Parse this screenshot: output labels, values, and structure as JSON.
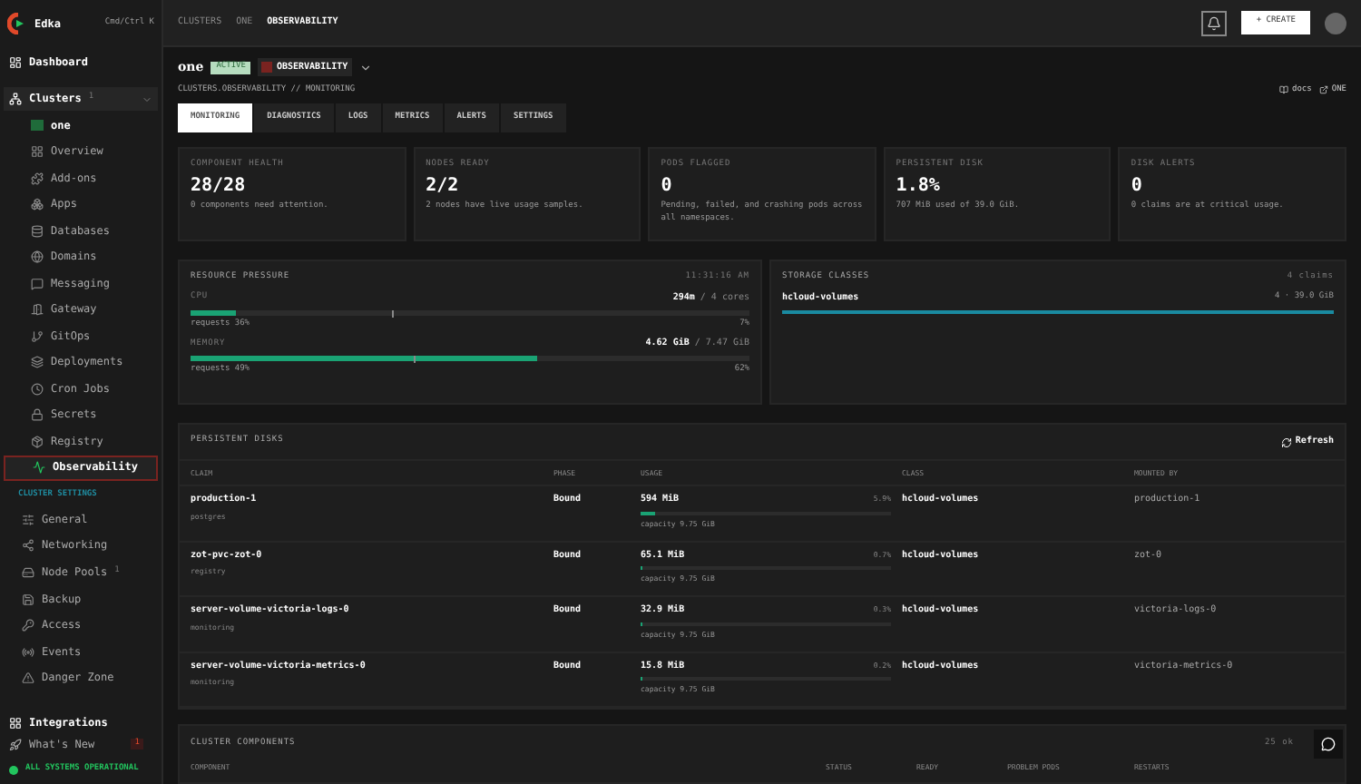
{
  "brand": {
    "name": "Edka",
    "shortcut": "Cmd/Ctrl K"
  },
  "sidebar": {
    "dashboard": "Dashboard",
    "clusters": {
      "label": "Clusters",
      "count": "1",
      "expanded": true
    },
    "items": [
      {
        "label": "one",
        "selected": false,
        "kind": "cluster"
      },
      {
        "label": "Overview",
        "selected": false,
        "kind": "page"
      },
      {
        "label": "Add-ons",
        "selected": false,
        "kind": "page"
      },
      {
        "label": "Apps",
        "selected": false,
        "kind": "page"
      },
      {
        "label": "Databases",
        "selected": false,
        "kind": "page"
      },
      {
        "label": "Domains",
        "selected": false,
        "kind": "page"
      },
      {
        "label": "Messaging",
        "selected": false,
        "kind": "page"
      },
      {
        "label": "Gateway",
        "selected": false,
        "kind": "page"
      },
      {
        "label": "GitOps",
        "selected": false,
        "kind": "page"
      },
      {
        "label": "Deployments",
        "selected": false,
        "kind": "page"
      },
      {
        "label": "Cron Jobs",
        "selected": false,
        "kind": "page"
      },
      {
        "label": "Secrets",
        "selected": false,
        "kind": "page"
      },
      {
        "label": "Registry",
        "selected": false,
        "kind": "page"
      },
      {
        "label": "Observability",
        "selected": true,
        "kind": "page"
      }
    ],
    "settings_heading": "CLUSTER SETTINGS",
    "settings": [
      {
        "label": "General"
      },
      {
        "label": "Networking"
      },
      {
        "label": "Node Pools",
        "count": "1"
      },
      {
        "label": "Backup"
      },
      {
        "label": "Access"
      },
      {
        "label": "Events"
      },
      {
        "label": "Danger Zone"
      }
    ],
    "integrations": "Integrations",
    "whats_new": {
      "label": "What's New",
      "badge": "1"
    },
    "status": "ALL SYSTEMS OPERATIONAL"
  },
  "topbar": {
    "breadcrumbs": [
      {
        "label": "CLUSTERS",
        "selected": false
      },
      {
        "label": "ONE",
        "selected": false
      },
      {
        "label": "OBSERVABILITY",
        "selected": true
      }
    ],
    "create": "+ CREATE"
  },
  "header": {
    "cluster": "one",
    "status": "ACTIVE",
    "section": "OBSERVABILITY",
    "path": "CLUSTERS.OBSERVABILITY // MONITORING",
    "docs": "docs",
    "cluster_link": "ONE"
  },
  "tabs": [
    {
      "label": "MONITORING",
      "selected": true
    },
    {
      "label": "DIAGNOSTICS",
      "selected": false
    },
    {
      "label": "LOGS",
      "selected": false
    },
    {
      "label": "METRICS",
      "selected": false
    },
    {
      "label": "ALERTS",
      "selected": false
    },
    {
      "label": "SETTINGS",
      "selected": false
    }
  ],
  "stats": [
    {
      "label": "COMPONENT HEALTH",
      "value": "28/28",
      "note": "0 components need attention."
    },
    {
      "label": "NODES READY",
      "value": "2/2",
      "note": "2 nodes have live usage samples."
    },
    {
      "label": "PODS FLAGGED",
      "value": "0",
      "note": "Pending, failed, and crashing pods across all namespaces."
    },
    {
      "label": "PERSISTENT DISK",
      "value": "1.8%",
      "note": "707 MiB used of 39.0 GiB."
    },
    {
      "label": "DISK ALERTS",
      "value": "0",
      "note": "0 claims are at critical usage."
    }
  ],
  "resource_pressure": {
    "title": "RESOURCE PRESSURE",
    "time": "11:31:16 AM",
    "meters": [
      {
        "name": "CPU",
        "used": "294m",
        "total": "/ 4 cores",
        "level": 0.08,
        "request": {
          "level": 0.36
        },
        "requests": "requests 36%",
        "percent": "7%"
      },
      {
        "name": "MEMORY",
        "used": "4.62 GiB",
        "total": "/ 7.47 GiB",
        "level": 0.62,
        "request": {
          "level": 0.4
        },
        "requests": "requests 49%",
        "percent": "62%"
      }
    ]
  },
  "storage_classes": {
    "title": "STORAGE CLASSES",
    "count": "4 claims",
    "items": [
      {
        "name": "hcloud-volumes",
        "summary": "4 · 39.0 GiB",
        "level": 1
      }
    ]
  },
  "persistent_disks": {
    "title": "PERSISTENT DISKS",
    "refresh": "Refresh",
    "columns": [
      "CLAIM",
      "PHASE",
      "USAGE",
      "CLASS",
      "MOUNTED BY"
    ],
    "rows": [
      {
        "claim": "production-1",
        "namespace": "postgres",
        "phase": "Bound",
        "used": "594 MiB",
        "percent": "5.9%",
        "level": 0.059,
        "capacity": "capacity 9.75 GiB",
        "class": "hcloud-volumes",
        "mounted_by": "production-1"
      },
      {
        "claim": "zot-pvc-zot-0",
        "namespace": "registry",
        "phase": "Bound",
        "used": "65.1 MiB",
        "percent": "0.7%",
        "level": 0.007,
        "capacity": "capacity 9.75 GiB",
        "class": "hcloud-volumes",
        "mounted_by": "zot-0"
      },
      {
        "claim": "server-volume-victoria-logs-0",
        "namespace": "monitoring",
        "phase": "Bound",
        "used": "32.9 MiB",
        "percent": "0.3%",
        "level": 0.003,
        "capacity": "capacity 9.75 GiB",
        "class": "hcloud-volumes",
        "mounted_by": "victoria-logs-0"
      },
      {
        "claim": "server-volume-victoria-metrics-0",
        "namespace": "monitoring",
        "phase": "Bound",
        "used": "15.8 MiB",
        "percent": "0.2%",
        "level": 0.002,
        "capacity": "capacity 9.75 GiB",
        "class": "hcloud-volumes",
        "mounted_by": "victoria-metrics-0"
      }
    ]
  },
  "cluster_components": {
    "title": "CLUSTER COMPONENTS",
    "count": "25 ok",
    "columns": [
      "COMPONENT",
      "STATUS",
      "READY",
      "PROBLEM PODS",
      "RESTARTS"
    ]
  }
}
